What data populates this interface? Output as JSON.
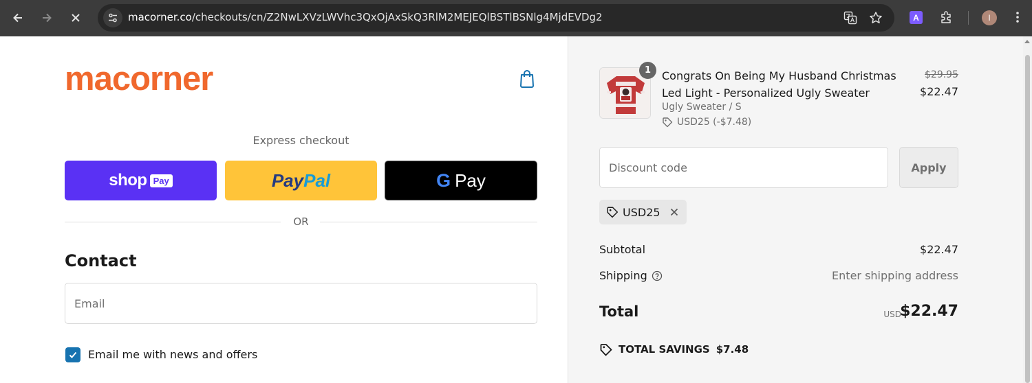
{
  "browser": {
    "url_host": "macorner.co",
    "url_path": "/checkouts/cn/Z2NwLXVzLWVhc3QxOjAxSkQ3RlM2MEJEQlBSTlBSNlg4MjdEVDg2",
    "extension_label": "A",
    "profile_initial": "I"
  },
  "store": {
    "logo_text": "macorner",
    "brand_color": "#f0682d"
  },
  "express": {
    "label": "Express checkout",
    "shop_word": "shop",
    "shop_badge": "Pay",
    "paypal_part1": "Pay",
    "paypal_part2": "Pal",
    "gpay_g": "G",
    "gpay_word": "Pay",
    "or_label": "OR"
  },
  "contact": {
    "heading": "Contact",
    "email_placeholder": "Email",
    "newsletter_label": "Email me with news and offers",
    "newsletter_checked": true
  },
  "order": {
    "quantity": "1",
    "product_title": "Congrats On Being My Husband Christmas Led Light - Personalized Ugly Sweater",
    "variant": "Ugly Sweater / S",
    "discount_line": "USD25 (-$7.48)",
    "original_price": "$29.95",
    "price": "$22.47",
    "discount_placeholder": "Discount code",
    "apply_label": "Apply",
    "applied_code": "USD25",
    "subtotal_label": "Subtotal",
    "subtotal_value": "$22.47",
    "shipping_label": "Shipping",
    "shipping_value": "Enter shipping address",
    "total_label": "Total",
    "total_currency": "USD",
    "total_value": "$22.47",
    "savings_label": "TOTAL SAVINGS",
    "savings_value": "$7.48"
  },
  "colors": {
    "shop_pay": "#5a31f4",
    "paypal": "#ffc439",
    "checkbox": "#1773b0"
  }
}
